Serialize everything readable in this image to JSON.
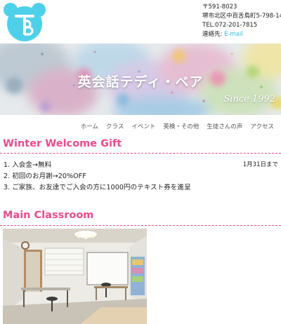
{
  "header": {
    "logo_alt": "teddy-bear logo",
    "postal": "〒591-8023",
    "address": "堺市北区中百舌鳥町5-798-14",
    "tel": "TEL.072-201-7815",
    "contact_label": "連絡先: ",
    "email_link": "E-mail"
  },
  "hero": {
    "title": "英会話テディ・ベア",
    "since": "Since 1992"
  },
  "nav": {
    "items": [
      "ホーム",
      "クラス",
      "イベント",
      "英検・その他",
      "生徒さんの声",
      "アクセス"
    ]
  },
  "gift": {
    "title": "Winter Welcome Gift",
    "date": "1月31日まで",
    "items": [
      "1. 入会金→無料",
      "2. 初回のお月謝→20%OFF",
      "3. ご家族、お友達でご入会の方に1000円のテキスト券を進呈"
    ]
  },
  "classroom": {
    "title": "Main Classroom"
  },
  "colors": {
    "accent_pink": "#ee4a8a",
    "link_cyan": "#33bde0",
    "logo_cyan": "#4fd0ea"
  }
}
